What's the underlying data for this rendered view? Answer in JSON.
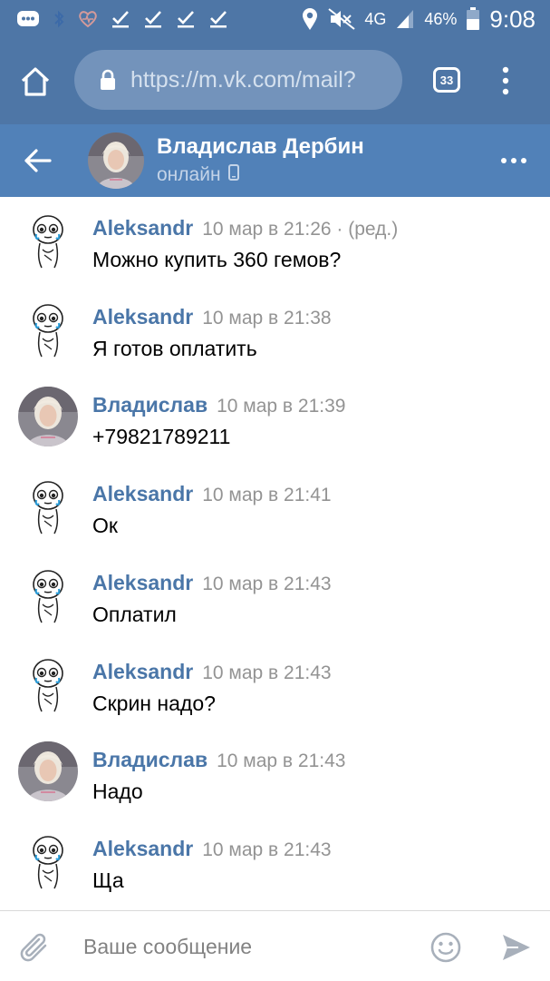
{
  "status_bar": {
    "battery": "46%",
    "time": "9:08",
    "network": "4G",
    "icons": [
      "messenger-icon",
      "bluetooth-icon",
      "heart-icon",
      "check-icon",
      "check-icon",
      "check-icon",
      "check-icon",
      "location-icon",
      "mute-icon",
      "signal-icon",
      "battery-icon"
    ]
  },
  "browser": {
    "url": "https://m.vk.com/mail?",
    "tab_count": "33"
  },
  "chat_header": {
    "name": "Владислав Дербин",
    "status": "онлайн"
  },
  "messages": [
    {
      "author": "Aleksandr",
      "time": "10 мар в 21:26 · (ред.)",
      "text": "Можно купить 360 гемов?",
      "sender": "aleksandr"
    },
    {
      "author": "Aleksandr",
      "time": "10 мар в 21:38",
      "text": "Я готов оплатить",
      "sender": "aleksandr"
    },
    {
      "author": "Владислав",
      "time": "10 мар в 21:39",
      "text": "+79821789211",
      "sender": "vladislav"
    },
    {
      "author": "Aleksandr",
      "time": "10 мар в 21:41",
      "text": "Ок",
      "sender": "aleksandr"
    },
    {
      "author": "Aleksandr",
      "time": "10 мар в 21:43",
      "text": "Оплатил",
      "sender": "aleksandr"
    },
    {
      "author": "Aleksandr",
      "time": "10 мар в 21:43",
      "text": "Скрин надо?",
      "sender": "aleksandr"
    },
    {
      "author": "Владислав",
      "time": "10 мар в 21:43",
      "text": "Надо",
      "sender": "vladislav"
    },
    {
      "author": "Aleksandr",
      "time": "10 мар в 21:43",
      "text": "Ща",
      "sender": "aleksandr"
    }
  ],
  "composer": {
    "placeholder": "Ваше сообщение"
  },
  "colors": {
    "status_bar": "#4e76a6",
    "header": "#5181b8",
    "author": "#4a76a8",
    "time": "#939393"
  }
}
